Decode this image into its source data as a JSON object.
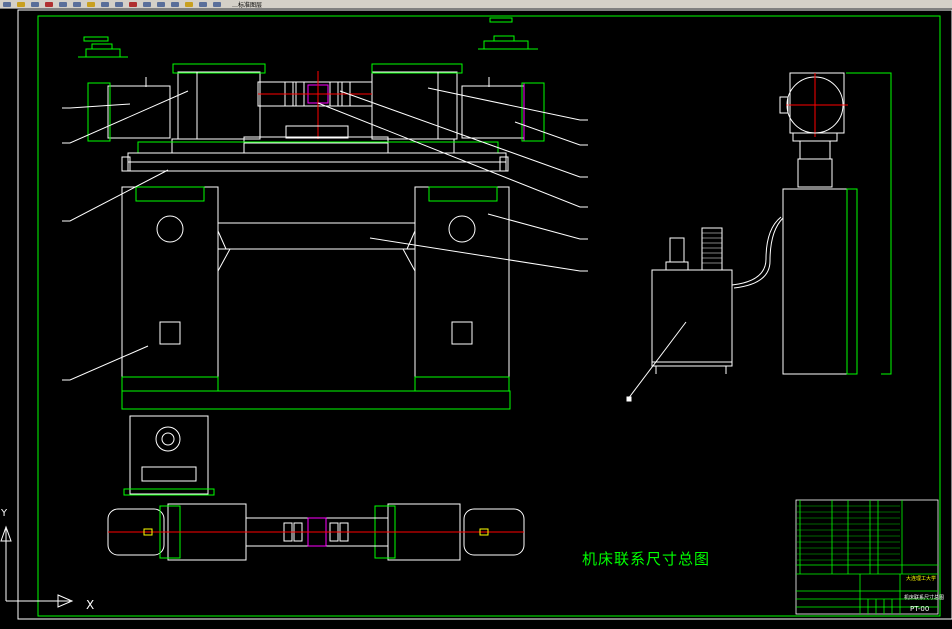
{
  "app": {
    "toolbar_text": "…标准图层"
  },
  "drawing": {
    "title": "机床联系尺寸总图",
    "title_block": {
      "company": "大连理工大学",
      "drawing_name": "机床联系尺寸总图",
      "drawing_number": "PT-00"
    },
    "ucs": {
      "x_label": "X",
      "y_label": "Y"
    }
  },
  "colors": {
    "background": "#000000",
    "line_white": "#ffffff",
    "line_green": "#00ff00",
    "line_red": "#ff0000",
    "line_magenta": "#ff00ff",
    "line_yellow": "#ffff00"
  }
}
